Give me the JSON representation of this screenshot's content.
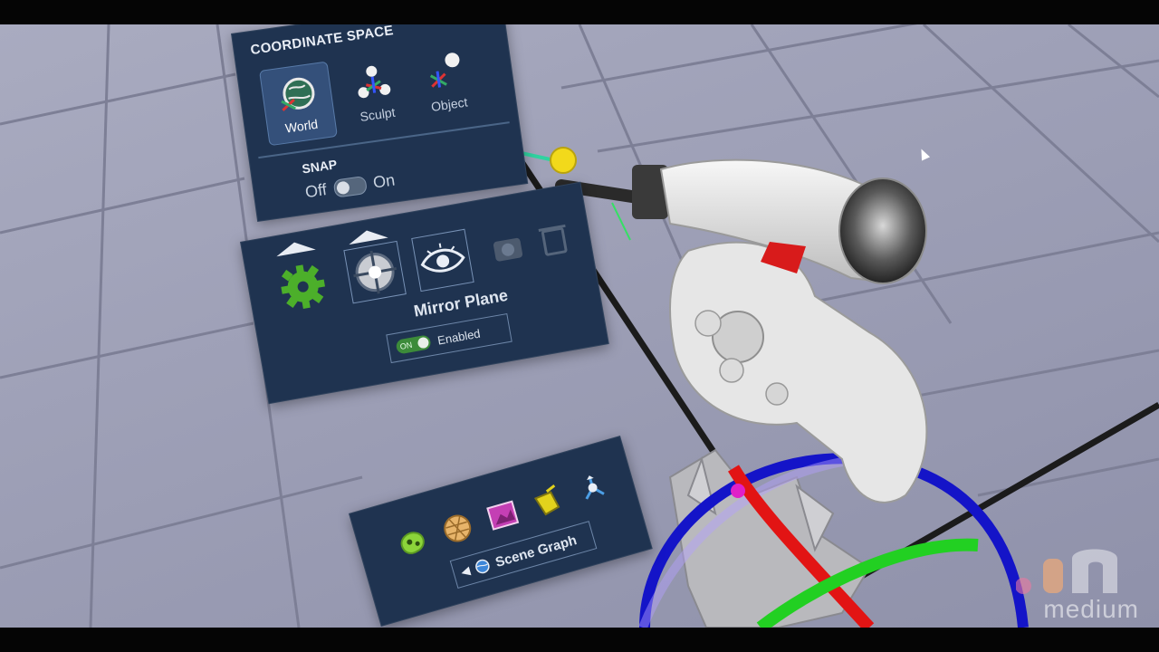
{
  "coordinate_space": {
    "title": "COORDINATE SPACE",
    "options": [
      {
        "label": "World",
        "icon": "globe-icon",
        "active": true
      },
      {
        "label": "Sculpt",
        "icon": "axes-icon",
        "active": false
      },
      {
        "label": "Object",
        "icon": "object-axes-icon",
        "active": false
      }
    ]
  },
  "snap": {
    "title": "SNAP",
    "off_label": "Off",
    "on_label": "On",
    "state": "off"
  },
  "mirror_plane": {
    "title": "Mirror Plane",
    "toggle_state_label": "ON",
    "toggle_label": "Enabled",
    "tools": [
      "gear-icon",
      "mirror-plane-icon",
      "eye-icon",
      "camera-icon",
      "trash-icon"
    ]
  },
  "scene_graph": {
    "button_label": "Scene Graph",
    "shapes": [
      "blob-icon",
      "geodesic-sphere-icon",
      "image-layer-icon",
      "paint-bucket-icon",
      "group-node-icon"
    ]
  },
  "watermark": {
    "text": "medium"
  },
  "colors": {
    "panel_bg": "#1f3350",
    "laser": "#2fd3a0",
    "gizmo_red": "#e01010",
    "gizmo_green": "#20d020",
    "gizmo_blue": "#1010c8",
    "gear_green": "#4caf2a"
  }
}
